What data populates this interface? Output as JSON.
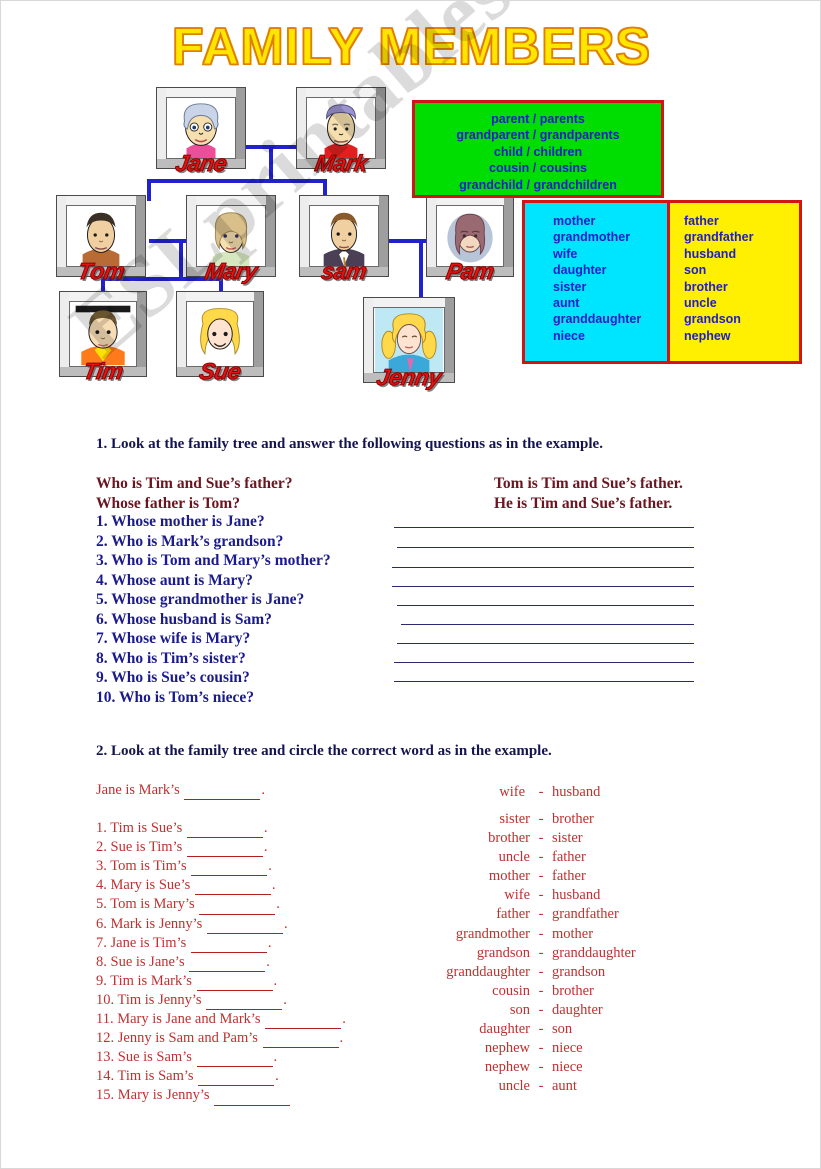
{
  "title": "FAMILY MEMBERS",
  "watermark": "ESLprintables.com",
  "colors": {
    "title_fill": "#ffe600",
    "title_outline": "#e08000",
    "box_border": "#d21414",
    "green_box": "#00dd00",
    "cyan_box": "#00e5ff",
    "yellow_box": "#ffef00",
    "vocab_text": "#2020c8",
    "tree_line": "#2222cc",
    "name_tag": "#e21313",
    "heading_text": "#141450",
    "question_text": "#1b1b8c",
    "example_text": "#6b1520",
    "ex2_text": "#c03030",
    "highlight": "#ffee00"
  },
  "family_tree": {
    "people": [
      {
        "name": "Jane",
        "generation": 1
      },
      {
        "name": "Mark",
        "generation": 1
      },
      {
        "name": "Tom",
        "generation": 2
      },
      {
        "name": "Mary",
        "generation": 2
      },
      {
        "name": "sam",
        "generation": 2
      },
      {
        "name": "Pam",
        "generation": 2
      },
      {
        "name": "Tim",
        "generation": 3
      },
      {
        "name": "Sue",
        "generation": 3
      },
      {
        "name": "Jenny",
        "generation": 3
      }
    ]
  },
  "vocab_green": [
    "parent / parents",
    "grandparent / grandparents",
    "child / children",
    "cousin / cousins",
    "grandchild / grandchildren"
  ],
  "vocab_cyan": [
    "mother",
    "grandmother",
    "wife",
    "daughter",
    "sister",
    "aunt",
    "granddaughter",
    "niece"
  ],
  "vocab_yellow": [
    "father",
    "grandfather",
    "husband",
    "son",
    "brother",
    "uncle",
    "grandson",
    "nephew"
  ],
  "exercise1": {
    "heading": "1. Look at the family tree and answer the following questions as in the example.",
    "example_questions": [
      "Who is Tim and Sue’s father?",
      "Whose father is Tom?"
    ],
    "example_answers": [
      "Tom is Tim and Sue’s father.",
      "He is Tim and Sue’s father."
    ],
    "questions": [
      "1. Whose mother is Jane?",
      "2. Who is Mark’s grandson?",
      "3. Who is Tom and Mary’s mother?",
      "4. Whose aunt is Mary?",
      "5. Whose grandmother is Jane?",
      "6. Whose husband is Sam?",
      "7. Whose wife is Mary?",
      "8. Who is Tim’s sister?",
      "9. Who is Sue’s cousin?",
      "10. Who is Tom’s niece?"
    ]
  },
  "exercise2": {
    "heading": "2. Look at the family tree and circle the correct word as in the example.",
    "example": {
      "prompt": "Jane is Mark’s",
      "option_left": "wife",
      "dash": "-",
      "option_right": "husband",
      "circled": "left"
    },
    "items": [
      {
        "prompt": "1.  Tim is Sue’s",
        "option_left": "sister",
        "dash": "-",
        "option_right": "brother"
      },
      {
        "prompt": "2.  Sue is Tim’s",
        "option_left": "brother",
        "dash": "-",
        "option_right": "sister"
      },
      {
        "prompt": "3. Tom is Tim’s",
        "option_left": "uncle",
        "dash": "-",
        "option_right": "father"
      },
      {
        "prompt": "4. Mary is Sue’s",
        "option_left": "mother",
        "dash": "-",
        "option_right": "father"
      },
      {
        "prompt": "5. Tom is Mary’s",
        "option_left": "wife",
        "dash": "-",
        "option_right": "husband"
      },
      {
        "prompt": "6. Mark is Jenny’s",
        "option_left": "father",
        "dash": "-",
        "option_right": "grandfather"
      },
      {
        "prompt": "7. Jane is Tim’s",
        "option_left": "grandmother",
        "dash": "-",
        "option_right": "mother"
      },
      {
        "prompt": "8. Sue is Jane’s",
        "option_left": "grandson",
        "dash": "-",
        "option_right": "granddaughter"
      },
      {
        "prompt": "9.  Tim is Mark’s",
        "option_left": "granddaughter",
        "dash": "-",
        "option_right": "grandson"
      },
      {
        "prompt": "10. Tim is Jenny’s",
        "option_left": "cousin",
        "dash": "-",
        "option_right": "brother"
      },
      {
        "prompt": "11. Mary is Jane and Mark’s",
        "option_left": "son",
        "dash": "-",
        "option_right": "daughter"
      },
      {
        "prompt": "12. Jenny is Sam and Pam’s",
        "option_left": "daughter",
        "dash": "-",
        "option_right": "son"
      },
      {
        "prompt": "13. Sue is Sam’s",
        "option_left": "nephew",
        "dash": "-",
        "option_right": "niece"
      },
      {
        "prompt": "14. Tim is Sam’s",
        "option_left": "nephew",
        "dash": "-",
        "option_right": "niece"
      },
      {
        "prompt": "15. Mary is Jenny’s",
        "option_left": "uncle",
        "dash": "-",
        "option_right": "aunt"
      }
    ]
  }
}
